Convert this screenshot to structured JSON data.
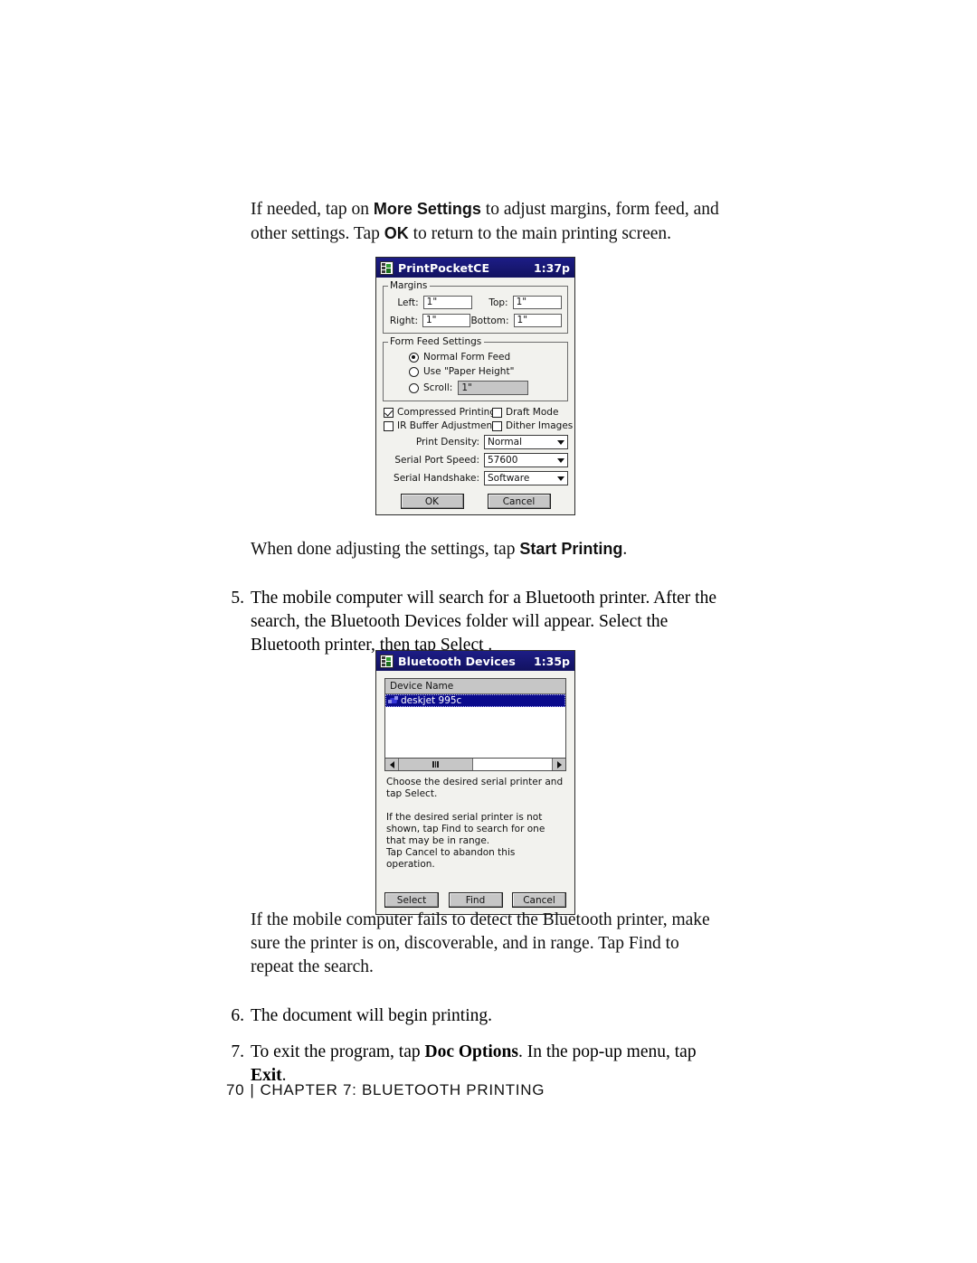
{
  "document": {
    "paragraphs": {
      "intro_1": "If needed, tap on ",
      "intro_bold_1": "More Settings",
      "intro_2": " to adjust margins, form feed, and other settings. Tap ",
      "intro_bold_2": "OK",
      "intro_3": " to return to the main printing screen.",
      "after_first_shot_1": "When done adjusting the settings, tap ",
      "after_first_shot_bold": "Start Printing",
      "after_first_shot_2": ".",
      "step5_num": "5.",
      "step5_text": "The mobile computer will search for a Bluetooth printer. After the search, the Bluetooth Devices folder will appear. Select the Bluetooth printer, then tap Select .",
      "after_second_shot": "If the mobile computer fails to detect the Bluetooth printer, make sure the printer is on, discoverable, and in range. Tap Find to repeat the search.",
      "step6_num": "6.",
      "step6_text": "The document will begin printing.",
      "step7_num": "7.",
      "step7_text_1": "To exit the program, tap ",
      "step7_bold_1": "Doc Options",
      "step7_text_2": ". In the pop-up menu, tap ",
      "step7_bold_2": "Exit",
      "step7_text_3": "."
    },
    "footer": {
      "page_number": "70",
      "separator": "|",
      "chapter": "CHAPTER 7: BLUETOOTH PRINTING"
    }
  },
  "print_dialog": {
    "title": "PrintPocketCE",
    "time": "1:37p",
    "margins": {
      "legend": "Margins",
      "left_label": "Left:",
      "left_value": "1\"",
      "top_label": "Top:",
      "top_value": "1\"",
      "right_label": "Right:",
      "right_value": "1\"",
      "bottom_label": "Bottom:",
      "bottom_value": "1\""
    },
    "form_feed": {
      "legend": "Form Feed Settings",
      "option_normal": "Normal Form Feed",
      "option_paper_height": "Use \"Paper Height\"",
      "option_scroll": "Scroll:",
      "scroll_value": "1\"",
      "selected": "Normal Form Feed"
    },
    "checkboxes": [
      {
        "label": "Compressed Printing",
        "checked": true
      },
      {
        "label": "Draft Mode",
        "checked": false
      },
      {
        "label": "IR Buffer Adjustment",
        "checked": false
      },
      {
        "label": "Dither Images",
        "checked": false
      }
    ],
    "dropdowns": [
      {
        "label": "Print Density:",
        "value": "Normal"
      },
      {
        "label": "Serial Port Speed:",
        "value": "57600"
      },
      {
        "label": "Serial Handshake:",
        "value": "Software"
      }
    ],
    "buttons": {
      "ok": "OK",
      "cancel": "Cancel"
    }
  },
  "bluetooth_dialog": {
    "title": "Bluetooth Devices",
    "time": "1:35p",
    "list": {
      "column_header": "Device Name",
      "rows": [
        {
          "name": "deskjet 995c",
          "selected": true
        }
      ]
    },
    "instructions_1": "Choose the desired serial printer and tap Select.",
    "instructions_2": "If the desired serial printer is not shown, tap Find to search for one that may be in range.",
    "instructions_3": "Tap Cancel to abandon this operation.",
    "buttons": {
      "select": "Select",
      "find": "Find",
      "cancel": "Cancel"
    }
  },
  "colors": {
    "titlebar": "#1b1b7a",
    "selection": "#0a0a8c",
    "dialog_bg": "#f2f2ee",
    "control_gray": "#c6c6c6"
  }
}
